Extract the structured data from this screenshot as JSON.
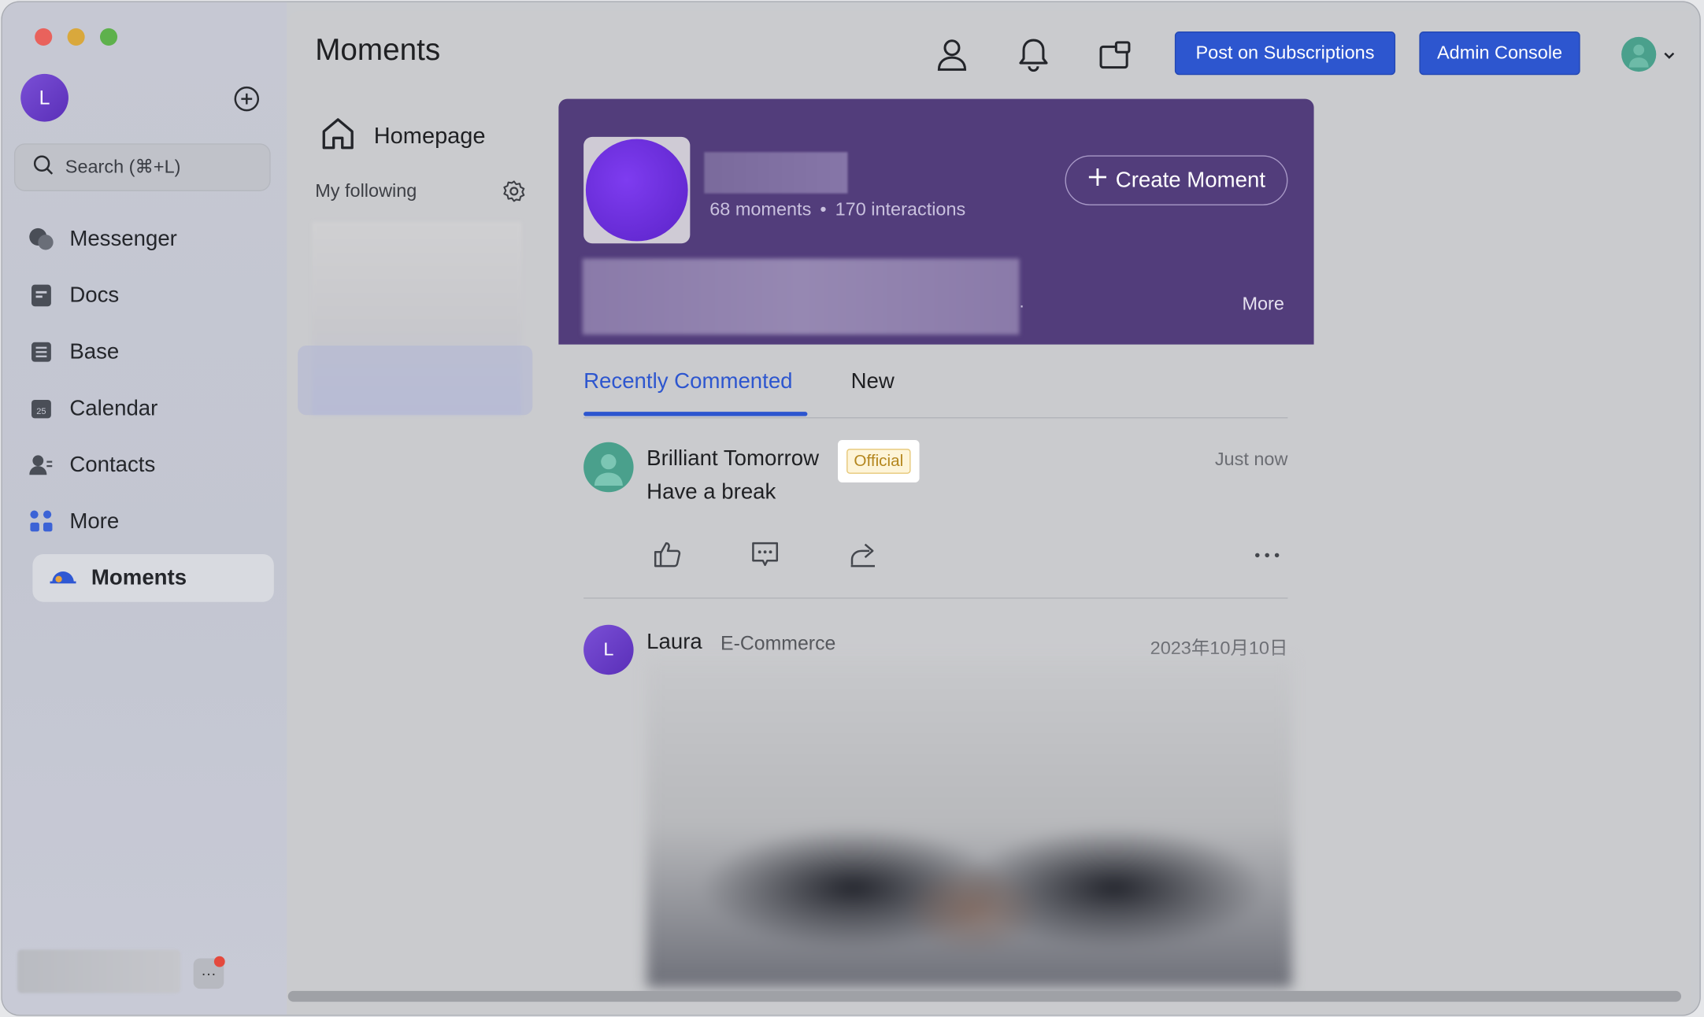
{
  "sidebar": {
    "avatar_initial": "L",
    "search_placeholder": "Search (⌘+L)",
    "items": [
      {
        "label": "Messenger",
        "icon": "messenger-icon"
      },
      {
        "label": "Docs",
        "icon": "docs-icon"
      },
      {
        "label": "Base",
        "icon": "base-icon"
      },
      {
        "label": "Calendar",
        "icon": "calendar-icon"
      },
      {
        "label": "Contacts",
        "icon": "contacts-icon"
      },
      {
        "label": "More",
        "icon": "more-apps-icon"
      },
      {
        "label": "Moments",
        "icon": "moments-icon",
        "active": true
      }
    ],
    "more_dots": "···"
  },
  "header": {
    "title": "Moments",
    "post_subscriptions_label": "Post on Subscriptions",
    "admin_console_label": "Admin Console"
  },
  "nav_panel": {
    "homepage_label": "Homepage",
    "following_label": "My following"
  },
  "banner": {
    "moments_count": "68 moments",
    "separator": "•",
    "interactions_count": "170 interactions",
    "create_label": "Create Moment",
    "period": ".",
    "more_label": "More"
  },
  "tabs": [
    {
      "label": "Recently Commented",
      "active": true
    },
    {
      "label": "New",
      "active": false
    }
  ],
  "posts": [
    {
      "author": "Brilliant Tomorrow",
      "badge": "Official",
      "time": "Just now",
      "text": "Have a break"
    },
    {
      "author": "Laura",
      "avatar_initial": "L",
      "department": "E-Commerce",
      "time": "2023年10月10日"
    }
  ],
  "colors": {
    "accent": "#2d56cf",
    "banner": "#523d7b",
    "official_text": "#b4861e"
  }
}
